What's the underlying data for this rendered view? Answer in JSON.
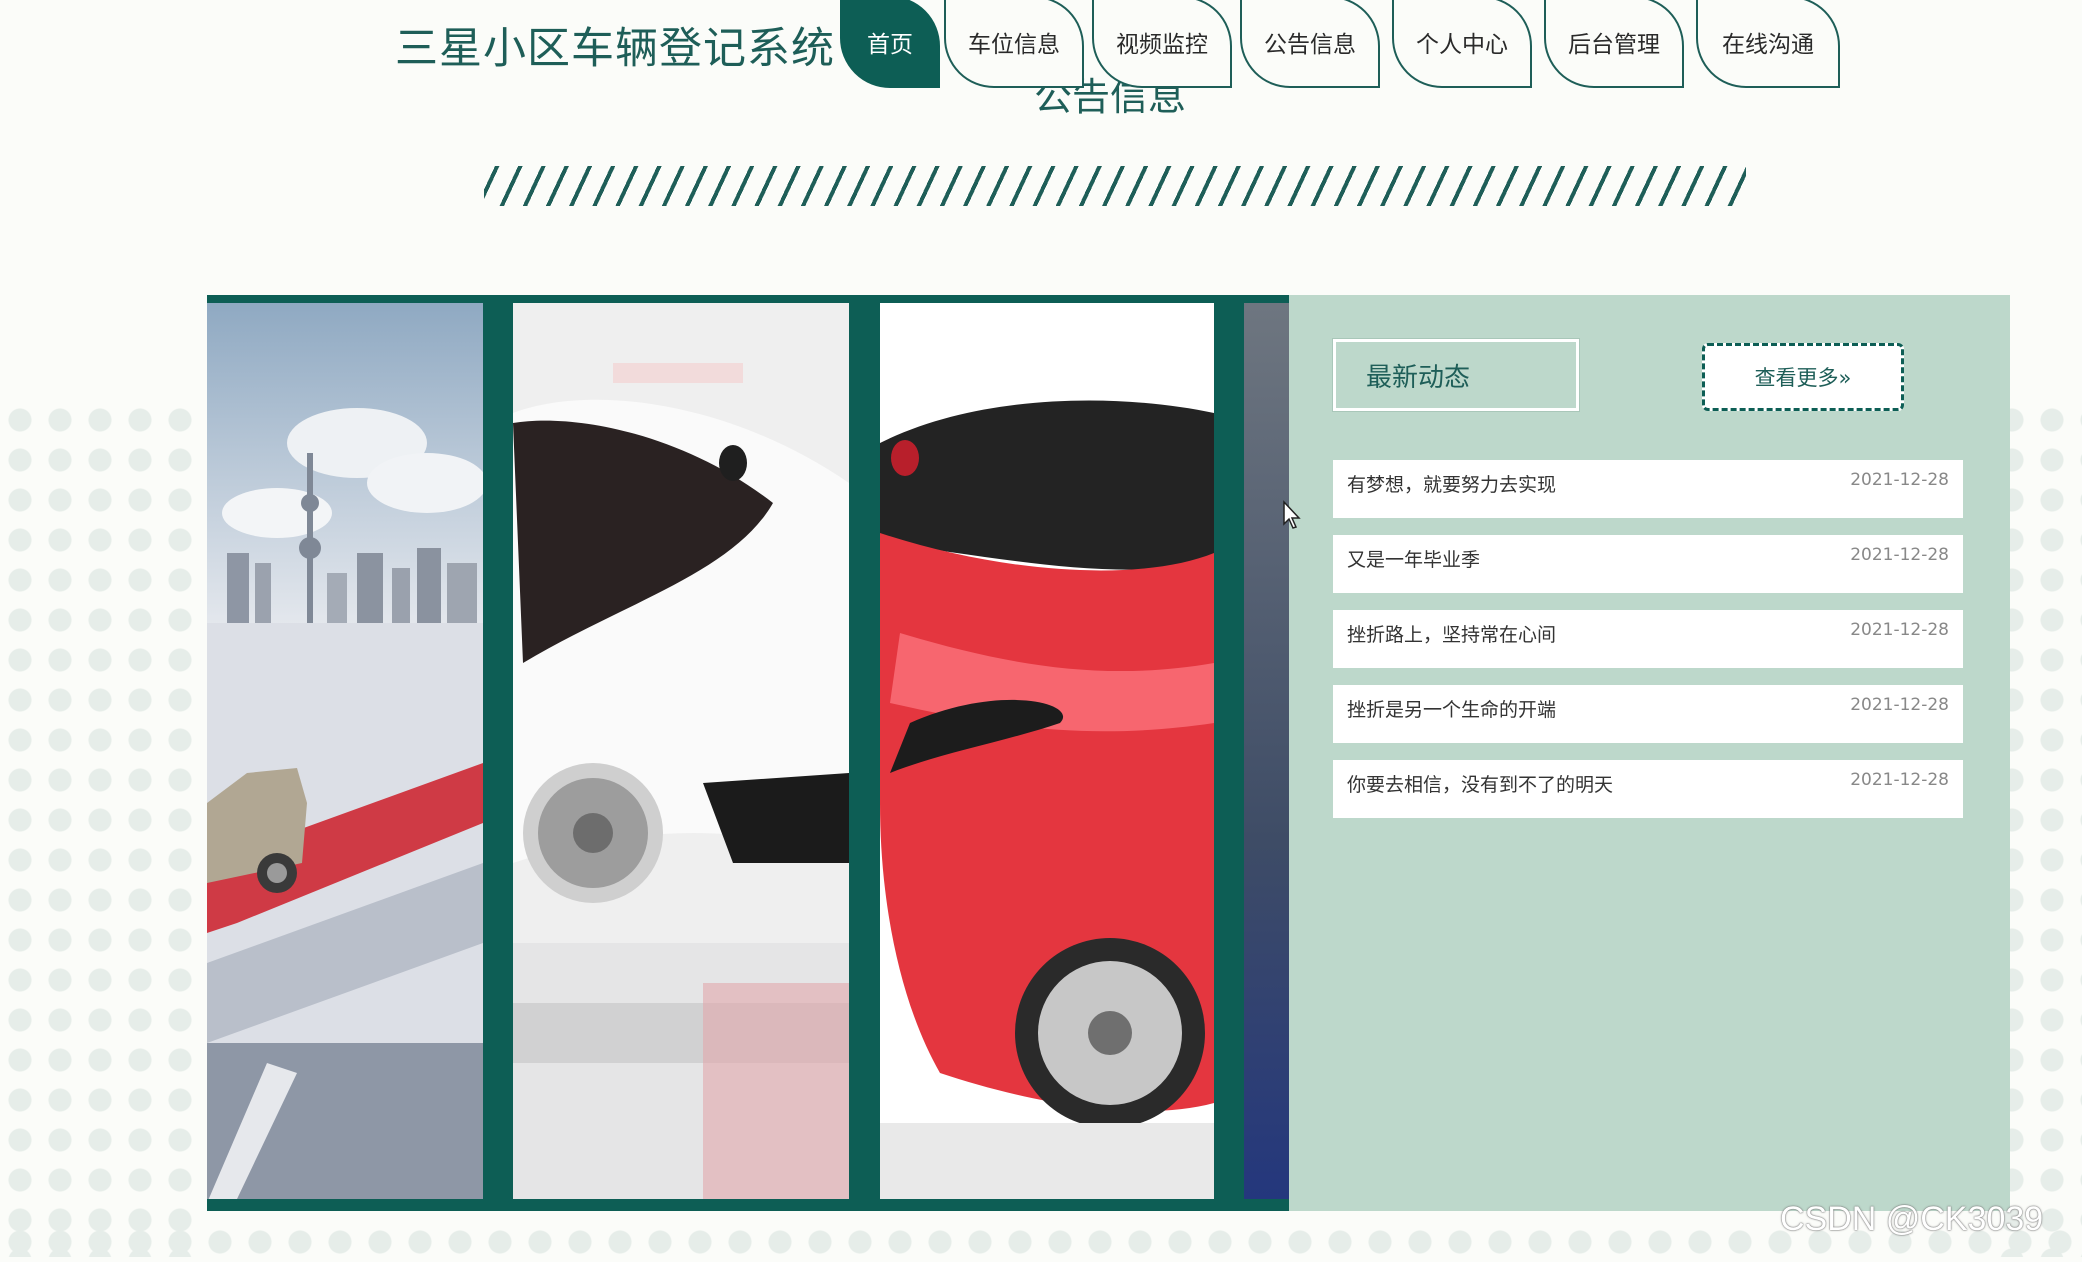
{
  "header": {
    "site_title": "三星小区车辆登记系统",
    "nav": [
      {
        "label": "首页",
        "active": true
      },
      {
        "label": "车位信息",
        "active": false
      },
      {
        "label": "视频监控",
        "active": false
      },
      {
        "label": "公告信息",
        "active": false
      },
      {
        "label": "个人中心",
        "active": false
      },
      {
        "label": "后台管理",
        "active": false
      },
      {
        "label": "在线沟通",
        "active": false
      }
    ]
  },
  "section": {
    "title": "公告信息"
  },
  "news": {
    "heading": "最新动态",
    "more_label": "查看更多»",
    "items": [
      {
        "title": "有梦想，就要努力去实现",
        "date": "2021-12-28"
      },
      {
        "title": "又是一年毕业季",
        "date": "2021-12-28"
      },
      {
        "title": "挫折路上，坚持常在心间",
        "date": "2021-12-28"
      },
      {
        "title": "挫折是另一个生命的开端",
        "date": "2021-12-28"
      },
      {
        "title": "你要去相信，没有到不了的明天",
        "date": "2021-12-28"
      }
    ]
  },
  "watermark": "CSDN @CK3039",
  "colors": {
    "primary": "#0d5e55",
    "sidebar_bg": "#bdd8cb",
    "page_bg": "#fbfcf9"
  },
  "icons": {
    "cursor": "mouse-pointer-icon"
  }
}
